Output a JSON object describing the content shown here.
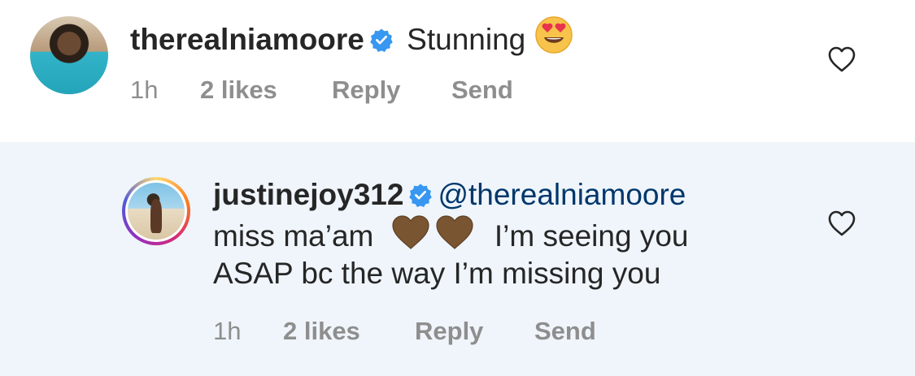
{
  "comments": [
    {
      "username": "therealniamoore",
      "text": "Stunning",
      "emoji": "heart-eyes-emoji",
      "time": "1h",
      "likes": "2 likes",
      "reply": "Reply",
      "send": "Send"
    },
    {
      "username": "justinejoy312",
      "mention": "@therealniamoore",
      "text_line1": "miss ma’am",
      "text_line1_end": "I’m seeing you",
      "text_line2": "ASAP bc the way I’m missing you",
      "emoji": "brown-heart-emoji",
      "time": "1h",
      "likes": "2 likes",
      "reply": "Reply",
      "send": "Send"
    }
  ],
  "colors": {
    "verified": "#3897f0",
    "mention": "#00376b",
    "meta": "#8e8e8e",
    "reply_highlight": "#eff5fb",
    "brown_heart": "#7a5532"
  }
}
